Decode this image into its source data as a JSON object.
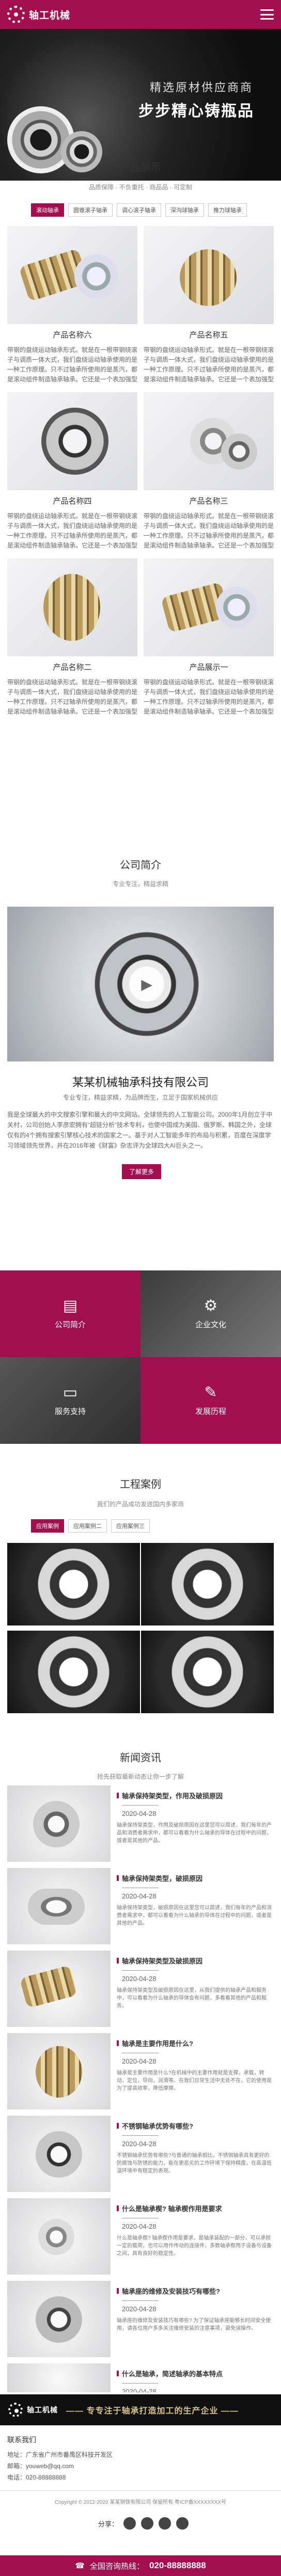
{
  "header": {
    "logo_text": "轴工机械"
  },
  "banner": {
    "line1": "精选原材供应商商",
    "line2": "步步精心铸瓶品"
  },
  "products": {
    "title": "产品展示",
    "subtitle": "品质保障 · 不负重托 · 商品品 · 可定制",
    "tabs": [
      "滚动轴承",
      "圆锥滚子轴承",
      "调心滚子轴承",
      "深沟球轴承",
      "推力球轴承"
    ],
    "items": [
      {
        "name": "产品名称六",
        "desc": "带钢的盘绕运动轴承形式。就是在一根带钢绕滚子与调质一体大式，我们盘绕运动轴承使用的是一种工作原理。只不过轴承所使用的是蒸汽，都是滚动组件制造轴承轴承。它还是一个表加强型设备。"
      },
      {
        "name": "产品名称五",
        "desc": "带钢的盘绕运动轴承形式。就是在一根带钢绕滚子与调质一体大式，我们盘绕运动轴承使用的是一种工作原理。只不过轴承所使用的是蒸汽，都是滚动组件制造轴承轴承。它还是一个表加强型设备。"
      },
      {
        "name": "产品名称四",
        "desc": "带钢的盘绕运动轴承形式。就是在一根带钢绕滚子与调质一体大式，我们盘绕运动轴承使用的是一种工作原理。只不过轴承所使用的是蒸汽，都是滚动组件制造轴承轴承。它还是一个表加强型设备。"
      },
      {
        "name": "产品名称三",
        "desc": "带钢的盘绕运动轴承形式。就是在一根带钢绕滚子与调质一体大式，我们盘绕运动轴承使用的是一种工作原理。只不过轴承所使用的是蒸汽，都是滚动组件制造轴承轴承。它还是一个表加强型设备。"
      },
      {
        "name": "产品名称二",
        "desc": "带钢的盘绕运动轴承形式。就是在一根带钢绕滚子与调质一体大式，我们盘绕运动轴承使用的是一种工作原理。只不过轴承所使用的是蒸汽，都是滚动组件制造轴承轴承。它还是一个表加强型设备。"
      },
      {
        "name": "产品展示一",
        "desc": "带钢的盘绕运动轴承形式。就是在一根带钢绕滚子与调质一体大式，我们盘绕运动轴承使用的是一种工作原理。只不过轴承所使用的是蒸汽，都是滚动组件制造轴承轴承。它还是一个表加强型设备。"
      }
    ]
  },
  "company": {
    "title": "公司简介",
    "subtitle": "专业专注，精益求精",
    "name": "某某机械轴承科技有限公司",
    "tagline": "专业专注，精益求精，为品牌而生，立足于国家机械供应",
    "body": "我是全球最大的中文搜索引擎和最大的中文网站。全球领先的人工智能公司。2000年1月创立于中关村，公司创始人李彦宏拥有“超链分析”技术专利，也使中国成为美国、俄罗斯、韩国之外，全球仅有的4个拥有搜索引擎核心技术的国家之一。基于对人工智能多年的布局与积累，百度在深度学习领域领先世界，并在2016年被《财富》杂志评为全球四大AI巨头之一。",
    "more": "了解更多"
  },
  "tiles": [
    {
      "label": "公司简介",
      "icon": "📋",
      "bg": "#a30f4e"
    },
    {
      "label": "企业文化",
      "icon": "⚙",
      "bg": "#a30f4e"
    },
    {
      "label": "服务支持",
      "icon": "🖥",
      "bg": "#a30f4e"
    },
    {
      "label": "发展历程",
      "icon": "💬",
      "bg": "#a30f4e"
    }
  ],
  "cases": {
    "title": "工程案例",
    "subtitle": "我们的产品成功发送国内多家商",
    "tabs": [
      "应用案例",
      "应用案例二",
      "应用案例三"
    ]
  },
  "news": {
    "title": "新闻资讯",
    "subtitle": "抢先获取最新动态让你一步了解",
    "items": [
      {
        "title": "轴承保持架类型，作用及破损原因",
        "date": "2020-04-28",
        "summary": "轴承保持架类型，作用及破损原因在这里您可以简述，我们每年的产品和消费者需求中，都可以看看为什么轴承的导体在过程中的问题，或者是其他的产品。"
      },
      {
        "title": "轴承保持架类型，破损原因",
        "date": "2020-04-28",
        "summary": "轴承保持架类型，破损原因在这里您可以简述，我们每年的产品和消费者需求中，都可以看看为什么轴承的导体在过程中的问题，或者是其他的产品。"
      },
      {
        "title": "轴承保持架类型及破损原因",
        "date": "2020-04-28",
        "summary": "轴承保持架类型及破损原因在这里，从我们提供的轴承产品和服务中，可以看看为什么轴承的导体会有问题，多看看其他的产品和服务。"
      },
      {
        "title": "轴承是主要作用是什么?",
        "date": "2020-04-28",
        "summary": "轴承是主要作用是什么?在机械中的主要作用就是支撑，承载，转动，定位，导向，润滑等。在我们日常生活中无处不在，它的使用是为了提高效率，降低摩擦。"
      },
      {
        "title": "不锈钢轴承优势有哪些?",
        "date": "2020-04-28",
        "summary": "不锈钢轴承优势有哪些?与普通的轴承相比，不锈钢轴承具有更好的防腐蚀与防锈的能力，能在更恶劣的工作环境下保持精度，在高温低温环境中有稳定的表现。"
      },
      {
        "title": "什么是轴承楔? 轴承楔作用是要求",
        "date": "2020-04-28",
        "summary": "什么是轴承楔? 轴承楔作用是要求，是轴承装配的一部分，可以承担一定的载荷，也可以用作传动的连接件，多数轴承楔用于设备与设备之间，具有良好的稳定性。"
      },
      {
        "title": "轴承座的维修及安装技巧有哪些?",
        "date": "2020-04-28",
        "summary": "轴承座的维修及安装技巧有哪些? 为了保证轴承座能够长时间安全使用，请各位用户多多关注维修安装的注意事项，避免误操作。"
      },
      {
        "title": "什么是轴承，简述轴承的基本特点",
        "date": "2020-04-28",
        "summary": "什么是轴承，简述轴承的基本特点，轴承是当代机械设备中一种重要零部件。它的主要功能是支撑机械旋转体，降低其运动过程中的摩擦系数，并保证其回转精度。"
      }
    ]
  },
  "footer": {
    "slogan": "—— 专专注于轴承打造加工的生产企业 ——",
    "contact_title": "联系我们",
    "address": "地址：广东省广州市番禺区科技开发区",
    "email": "邮箱：youweb@qq.com",
    "phone": "电话：020-88888888",
    "copyright": "Copyright © 2012-2020 某某钢铁有限公司 保留所有 粤ICP备XXXXXXXX号",
    "share_label": "分享：",
    "hotline_label": "全国咨询热线：",
    "hotline": "020-88888888"
  },
  "colors": {
    "brand": "#a30f4e",
    "footer": "#101010"
  }
}
